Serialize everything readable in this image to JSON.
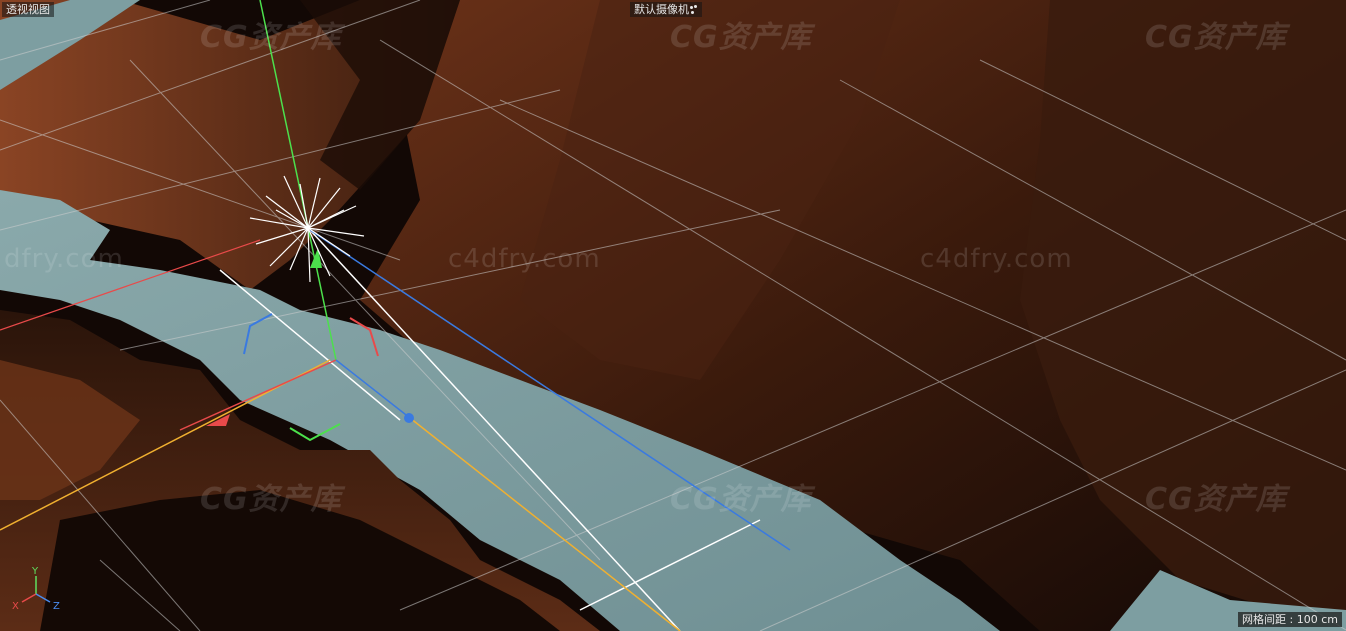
{
  "viewport": {
    "view_name": "透视视图",
    "camera_label": "默认摄像机",
    "camera_icon": "camera-dots-icon",
    "grid_spacing": "网格间距 : 100 cm"
  },
  "axis_gizmo": {
    "x_label": "X",
    "y_label": "Y",
    "z_label": "Z",
    "x_color": "#e84a4a",
    "y_color": "#5fe05f",
    "z_color": "#4a8cf0"
  },
  "watermarks": {
    "logo_text": "CG资产库",
    "url_text": "c4dfry.com",
    "url_text_partial": "dfry.com"
  },
  "colors": {
    "rock_dark": "#1a0c06",
    "rock_mid": "#5a2a14",
    "rock_light": "#9a4e28",
    "water": "#7d9ea1",
    "light_rays": "#ffffff",
    "axis_x": "#e84a4a",
    "axis_y": "#4ce04c",
    "axis_z": "#3a7ae0",
    "guide_yellow": "#f0b030"
  }
}
